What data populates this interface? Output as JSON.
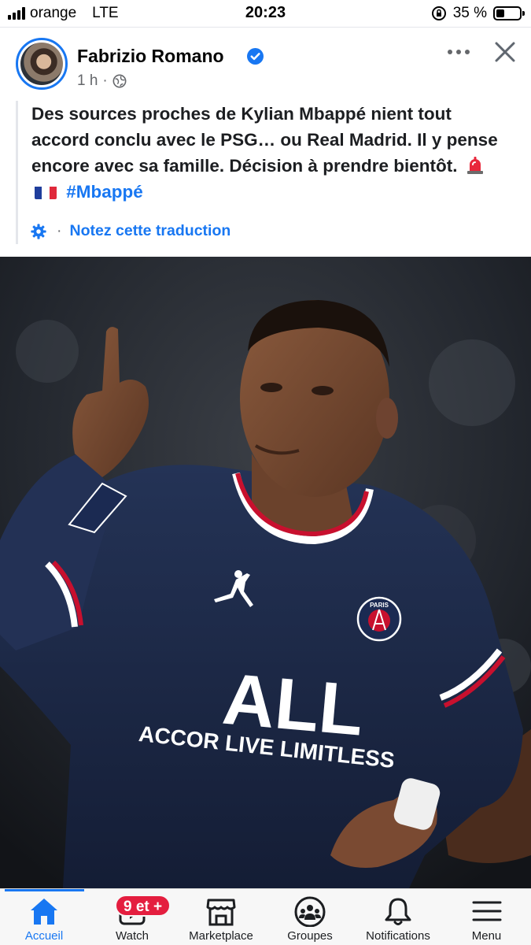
{
  "status_bar": {
    "carrier": "orange",
    "network": "LTE",
    "time": "20:23",
    "battery_text": "35 %",
    "battery_level": 0.35
  },
  "post": {
    "author": "Fabrizio Romano",
    "timestamp": "1 h",
    "meta_separator": "·",
    "text": "Des sources proches de Kylian Mbappé nient tout accord conclu avec le PSG… ou Real Madrid. Il y pense encore avec sa famille. Décision à prendre bientôt.",
    "hashtag": "#Mbappé",
    "translate_separator": "·",
    "translate_label": "Notez cette traduction",
    "icons": {
      "verified": "verified-badge-icon",
      "audience": "globe-icon",
      "more": "more-options-icon",
      "close": "close-icon",
      "settings": "gear-icon"
    },
    "photo": {
      "description_kind": "photo",
      "jersey_sponsor_line1": "ALL",
      "jersey_sponsor_line2": "ACCOR LIVE LIMITLESS",
      "crest_text": "PARIS"
    }
  },
  "nav": {
    "items": [
      {
        "label": "Accueil",
        "icon": "home-icon",
        "active": true
      },
      {
        "label": "Watch",
        "icon": "watch-icon",
        "active": false
      },
      {
        "label": "Marketplace",
        "icon": "marketplace-icon",
        "active": false
      },
      {
        "label": "Groupes",
        "icon": "groups-icon",
        "active": false
      },
      {
        "label": "Notifications",
        "icon": "bell-icon",
        "active": false
      },
      {
        "label": "Menu",
        "icon": "menu-icon",
        "active": false
      }
    ],
    "watch_badge": "9 et +"
  },
  "colors": {
    "accent": "#1877f2",
    "badge": "#e41e3f",
    "secondary_text": "#65676b"
  }
}
